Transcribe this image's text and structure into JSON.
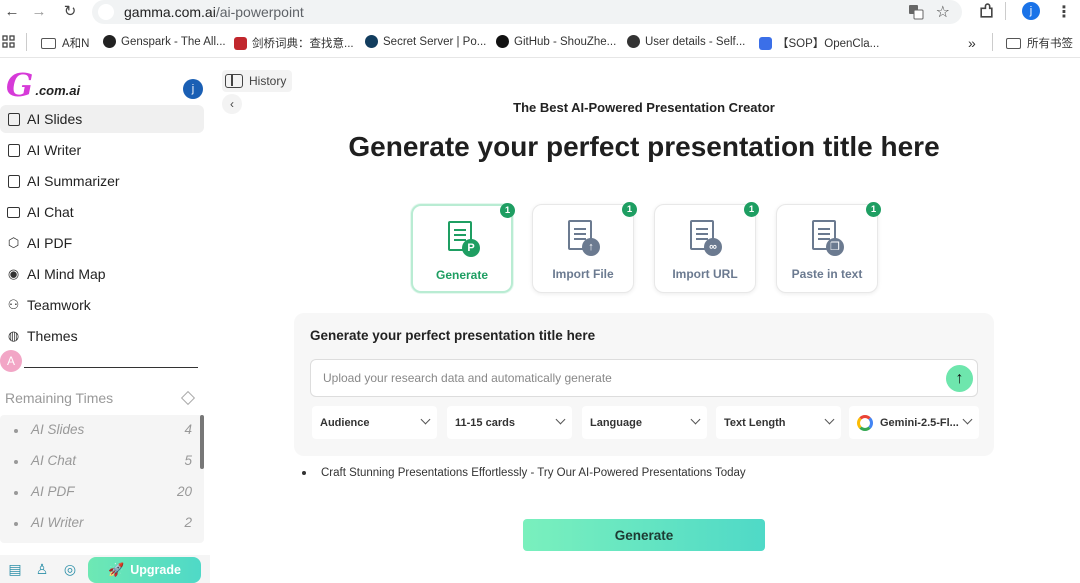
{
  "browser": {
    "url_host": "gamma.com.ai",
    "url_path": "/ai-powerpoint",
    "profile_initial": "j",
    "bookmarks": [
      {
        "label": "A和N",
        "icon": "folder-icon"
      },
      {
        "label": "Genspark - The All...",
        "icon": "genspark-icon"
      },
      {
        "label": "剑桥词典：查找意...",
        "icon": "cambridge-icon"
      },
      {
        "label": "Secret Server | Po...",
        "icon": "secret-server-icon"
      },
      {
        "label": "GitHub - ShouZhe...",
        "icon": "github-icon"
      },
      {
        "label": "User details - Self...",
        "icon": "globe-icon"
      },
      {
        "label": "【SOP】OpenCla...",
        "icon": "doc-icon"
      }
    ],
    "bookmarks_overflow": "»",
    "all_bookmarks": "所有书签"
  },
  "sidebar": {
    "logo_letter": "G",
    "logo_domain": ".com.ai",
    "avatar_initial": "j",
    "items": [
      {
        "label": "AI Slides",
        "icon": "slides-icon",
        "active": true
      },
      {
        "label": "AI Writer",
        "icon": "writer-icon"
      },
      {
        "label": "AI Summarizer",
        "icon": "summarizer-icon"
      },
      {
        "label": "AI Chat",
        "icon": "chat-icon"
      },
      {
        "label": "AI PDF",
        "icon": "pdf-icon"
      },
      {
        "label": "AI Mind Map",
        "icon": "mind-map-icon"
      },
      {
        "label": "Teamwork",
        "icon": "team-icon"
      },
      {
        "label": "Themes",
        "icon": "palette-icon"
      }
    ],
    "remaining_label": "Remaining Times",
    "remaining": [
      {
        "name": "AI Slides",
        "count": "4"
      },
      {
        "name": "AI Chat",
        "count": "5"
      },
      {
        "name": "AI PDF",
        "count": "20"
      },
      {
        "name": "AI Writer",
        "count": "2"
      }
    ],
    "upgrade_label": "Upgrade"
  },
  "main": {
    "history_label": "History",
    "subtitle": "The Best AI-Powered Presentation Creator",
    "headline": "Generate your perfect presentation title here",
    "options": [
      {
        "label": "Generate",
        "badge": "1",
        "icon": "generate-doc-icon",
        "selected": true
      },
      {
        "label": "Import File",
        "badge": "1",
        "icon": "import-file-icon"
      },
      {
        "label": "Import URL",
        "badge": "1",
        "icon": "import-url-icon"
      },
      {
        "label": "Paste in text",
        "badge": "1",
        "icon": "paste-text-icon"
      }
    ],
    "panel_title": "Generate your perfect presentation title here",
    "input_placeholder": "Upload your research data and automatically generate",
    "selects": [
      {
        "value": "Audience"
      },
      {
        "value": "11-15 cards"
      },
      {
        "value": "Language"
      },
      {
        "value": "Text Length"
      },
      {
        "value": "Gemini-2.5-Fl...",
        "icon": "google-icon"
      }
    ],
    "tip": "Craft Stunning Presentations Effortlessly - Try Our AI-Powered Presentations Today",
    "generate_label": "Generate"
  },
  "colors": {
    "accent_green": "#1e9e62",
    "button_gradient_start": "#7af0bd",
    "button_gradient_end": "#4fd9c7",
    "logo_pink": "#d63ad8"
  }
}
